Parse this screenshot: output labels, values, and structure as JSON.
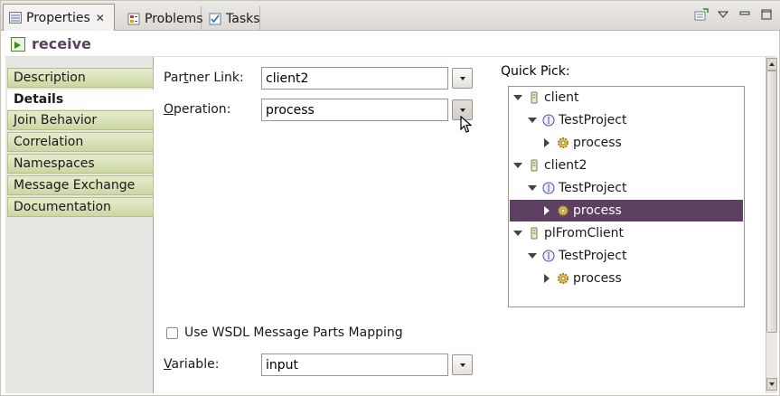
{
  "tabs": [
    {
      "label": "Properties",
      "icon": "properties-icon",
      "active": true
    },
    {
      "label": "Problems",
      "icon": "problems-icon",
      "active": false
    },
    {
      "label": "Tasks",
      "icon": "tasks-icon",
      "active": false
    }
  ],
  "view": {
    "title": "receive",
    "icon": "receive-activity-icon"
  },
  "nav": {
    "items": [
      {
        "label": "Description",
        "selected": false
      },
      {
        "label": "Details",
        "selected": true
      },
      {
        "label": "Join Behavior",
        "selected": false
      },
      {
        "label": "Correlation",
        "selected": false
      },
      {
        "label": "Namespaces",
        "selected": false
      },
      {
        "label": "Message Exchange",
        "selected": false
      },
      {
        "label": "Documentation",
        "selected": false
      }
    ]
  },
  "details": {
    "partner_link": {
      "label_pre": "Par",
      "label_u": "t",
      "label_post": "ner Link:",
      "value": "client2"
    },
    "operation": {
      "label_pre": "",
      "label_u": "O",
      "label_post": "peration:",
      "value": "process"
    },
    "wsdl_mapping": {
      "label": "Use WSDL Message Parts Mapping",
      "checked": false
    },
    "variable": {
      "label_pre": "",
      "label_u": "V",
      "label_post": "ariable:",
      "value": "input"
    }
  },
  "quick_pick": {
    "label": "Quick Pick:",
    "nodes": [
      {
        "label": "client",
        "level": 0,
        "expanded": true,
        "icon": "partner-link-icon",
        "selected": false
      },
      {
        "label": "TestProject",
        "level": 1,
        "expanded": true,
        "icon": "interface-icon",
        "selected": false
      },
      {
        "label": "process",
        "level": 2,
        "expanded": false,
        "icon": "operation-gear-icon",
        "selected": false
      },
      {
        "label": "client2",
        "level": 0,
        "expanded": true,
        "icon": "partner-link-icon",
        "selected": false
      },
      {
        "label": "TestProject",
        "level": 1,
        "expanded": true,
        "icon": "interface-icon",
        "selected": false
      },
      {
        "label": "process",
        "level": 2,
        "expanded": false,
        "icon": "operation-gear-icon",
        "selected": true
      },
      {
        "label": "plFromClient",
        "level": 0,
        "expanded": true,
        "icon": "partner-link-icon",
        "selected": false
      },
      {
        "label": "TestProject",
        "level": 1,
        "expanded": true,
        "icon": "interface-icon",
        "selected": false
      },
      {
        "label": "process",
        "level": 2,
        "expanded": false,
        "icon": "operation-gear-icon",
        "selected": false
      }
    ]
  },
  "colors": {
    "accent": "#5d3f62",
    "nav_tab": "#cbd7a1",
    "title": "#5c3f5c"
  }
}
